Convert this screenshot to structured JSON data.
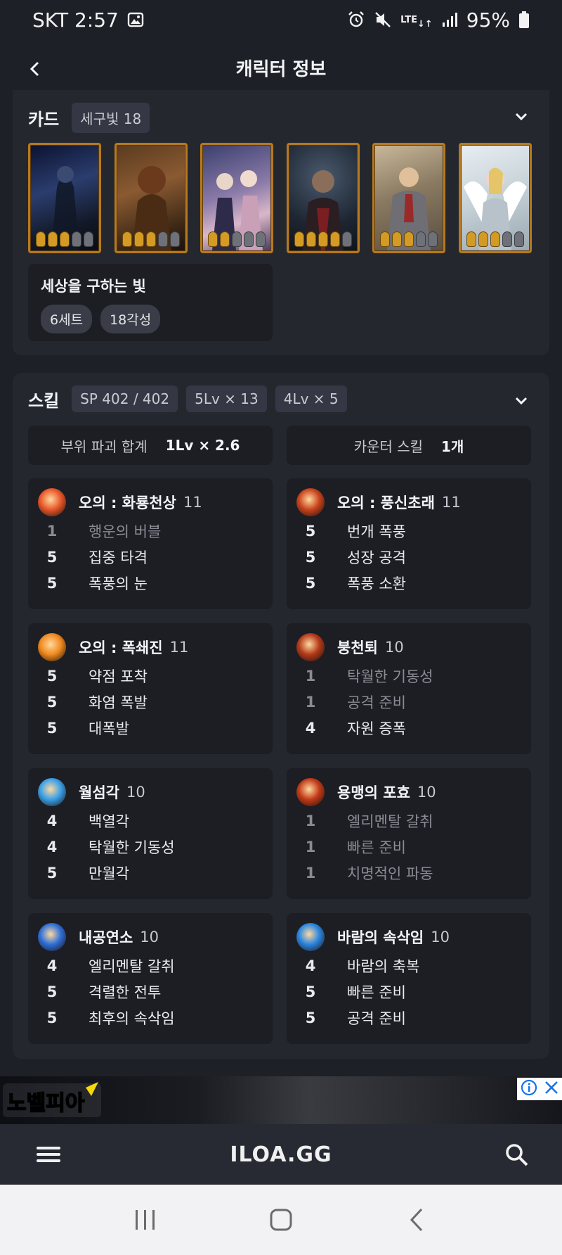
{
  "status_bar": {
    "carrier_time": "SKT 2:57",
    "battery": "95%",
    "lte_label": "LTE"
  },
  "header": {
    "title": "캐릭터 정보"
  },
  "cards": {
    "title": "카드",
    "set_chip": "세구빛 18",
    "card_items": [
      {
        "awakened": 3,
        "total": 5
      },
      {
        "awakened": 3,
        "total": 5
      },
      {
        "awakened": 2,
        "total": 5
      },
      {
        "awakened": 4,
        "total": 5
      },
      {
        "awakened": 3,
        "total": 5
      },
      {
        "awakened": 3,
        "total": 5
      }
    ],
    "set": {
      "name": "세상을 구하는 빛",
      "tags": [
        "6세트",
        "18각성"
      ]
    }
  },
  "skills": {
    "title": "스킬",
    "chips": [
      "SP 402 / 402",
      "5Lv × 13",
      "4Lv × 5"
    ],
    "summary": [
      {
        "label": "부위 파괴 합계",
        "value": "1Lv × 2.6"
      },
      {
        "label": "카운터 스킬",
        "value": "1개"
      }
    ],
    "items": [
      {
        "name": "오의 : 화룡천상",
        "level": "11",
        "icon_color": "#e8572a",
        "tripods": [
          {
            "lv": "1",
            "name": "행운의 버블",
            "dim": true
          },
          {
            "lv": "5",
            "name": "집중 타격",
            "dim": false
          },
          {
            "lv": "5",
            "name": "폭풍의 눈",
            "dim": false
          }
        ]
      },
      {
        "name": "오의 : 풍신초래",
        "level": "11",
        "icon_color": "#c8431c",
        "tripods": [
          {
            "lv": "5",
            "name": "번개 폭풍",
            "dim": false
          },
          {
            "lv": "5",
            "name": "성장 공격",
            "dim": false
          },
          {
            "lv": "5",
            "name": "폭풍 소환",
            "dim": false
          }
        ]
      },
      {
        "name": "오의 : 폭쇄진",
        "level": "11",
        "icon_color": "#f08a1e",
        "tripods": [
          {
            "lv": "5",
            "name": "약점 포착",
            "dim": false
          },
          {
            "lv": "5",
            "name": "화염 폭발",
            "dim": false
          },
          {
            "lv": "5",
            "name": "대폭발",
            "dim": false
          }
        ]
      },
      {
        "name": "붕천퇴",
        "level": "10",
        "icon_color": "#b33a1a",
        "tripods": [
          {
            "lv": "1",
            "name": "탁월한 기동성",
            "dim": true
          },
          {
            "lv": "1",
            "name": "공격 준비",
            "dim": true
          },
          {
            "lv": "4",
            "name": "자원 증폭",
            "dim": false
          }
        ]
      },
      {
        "name": "월섬각",
        "level": "10",
        "icon_color": "#3aa0e8",
        "tripods": [
          {
            "lv": "4",
            "name": "백열각",
            "dim": false
          },
          {
            "lv": "4",
            "name": "탁월한 기동성",
            "dim": false
          },
          {
            "lv": "5",
            "name": "만월각",
            "dim": false
          }
        ]
      },
      {
        "name": "용맹의 포효",
        "level": "10",
        "icon_color": "#c23a18",
        "tripods": [
          {
            "lv": "1",
            "name": "엘리멘탈 갈취",
            "dim": true
          },
          {
            "lv": "1",
            "name": "빠른 준비",
            "dim": true
          },
          {
            "lv": "1",
            "name": "치명적인 파동",
            "dim": true
          }
        ]
      },
      {
        "name": "내공연소",
        "level": "10",
        "icon_color": "#2f6fd8",
        "tripods": [
          {
            "lv": "4",
            "name": "엘리멘탈 갈취",
            "dim": false
          },
          {
            "lv": "5",
            "name": "격렬한 전투",
            "dim": false
          },
          {
            "lv": "5",
            "name": "최후의 속삭임",
            "dim": false
          }
        ]
      },
      {
        "name": "바람의 속삭임",
        "level": "10",
        "icon_color": "#2a86e0",
        "tripods": [
          {
            "lv": "4",
            "name": "바람의 축복",
            "dim": false
          },
          {
            "lv": "5",
            "name": "빠른 준비",
            "dim": false
          },
          {
            "lv": "5",
            "name": "공격 준비",
            "dim": false
          }
        ]
      }
    ]
  },
  "ad": {
    "logo_text": "노벨피아"
  },
  "bottom_bar": {
    "brand": "ILOA.GG"
  }
}
